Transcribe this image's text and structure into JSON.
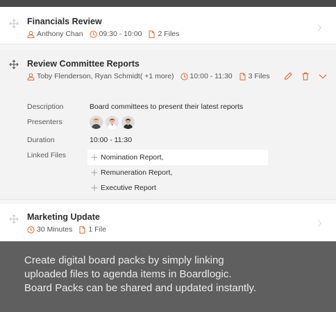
{
  "colors": {
    "accent": "#e06a2b",
    "top_bar": "#4a4a4a",
    "footer_bg": "#5f5f5f",
    "expanded_bg": "#f3f3f3"
  },
  "agenda": {
    "items": [
      {
        "title": "Financials Review",
        "presenters": "Anthony Chan",
        "time": "09:30 - 10:00",
        "files": "2 Files"
      },
      {
        "title": "Review Committee Reports",
        "presenters": "Toby Flenderson, Ryan Schmidt( +1 more)",
        "time": "10:00 - 11:30",
        "files": "3 Files",
        "details": {
          "description_label": "Description",
          "description": "Board committees to present their latest reports",
          "presenters_label": "Presenters",
          "duration_label": "Duration",
          "duration": "10:00 - 11:30",
          "linked_files_label": "Linked Files",
          "linked_files": [
            "Nomination Report,",
            "Remuneration Report,",
            "Executive Report"
          ]
        }
      },
      {
        "title": "Marketing Update",
        "time": "30 Minutes",
        "files": "1 File"
      }
    ]
  },
  "icons": {
    "drag": "drag-handle-icon",
    "user": "user-icon",
    "clock": "clock-icon",
    "file": "file-icon",
    "edit": "pencil-icon",
    "delete": "trash-icon",
    "chevron_down": "chevron-down-icon",
    "chevron_right": "chevron-right-icon"
  },
  "footer": {
    "line1": "Create digital board packs by simply linking",
    "line2": "uploaded files to agenda items in Boardlogic.",
    "line3": "Board Packs can be shared and updated instantly."
  }
}
